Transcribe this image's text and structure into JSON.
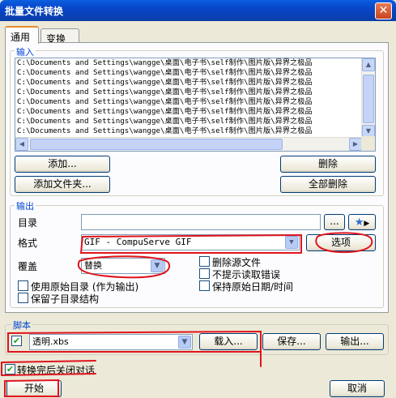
{
  "window": {
    "title": "批量文件转换",
    "close_glyph": "✕"
  },
  "tabs": [
    {
      "label": "通用",
      "active": true
    },
    {
      "label": "变换",
      "active": false
    }
  ],
  "input_group": {
    "label": "输入",
    "files": [
      "C:\\Documents and Settings\\wangge\\桌面\\电子书\\self制作\\图片版\\异界之极品",
      "C:\\Documents and Settings\\wangge\\桌面\\电子书\\self制作\\图片版\\异界之极品",
      "C:\\Documents and Settings\\wangge\\桌面\\电子书\\self制作\\图片版\\异界之极品",
      "C:\\Documents and Settings\\wangge\\桌面\\电子书\\self制作\\图片版\\异界之极品",
      "C:\\Documents and Settings\\wangge\\桌面\\电子书\\self制作\\图片版\\异界之极品",
      "C:\\Documents and Settings\\wangge\\桌面\\电子书\\self制作\\图片版\\异界之极品",
      "C:\\Documents and Settings\\wangge\\桌面\\电子书\\self制作\\图片版\\异界之极品",
      "C:\\Documents and Settings\\wangge\\桌面\\电子书\\self制作\\图片版\\异界之极品"
    ],
    "add_label": "添加...",
    "add_folder_label": "添加文件夹...",
    "delete_label": "删除",
    "delete_all_label": "全部删除"
  },
  "output_group": {
    "label": "输出",
    "dir_label": "目录",
    "dir_value": "",
    "browse_label": "...",
    "format_label": "格式",
    "format_value": "GIF - CompuServe GIF",
    "options_label": "选项",
    "overwrite_label": "覆盖",
    "overwrite_value": "替换",
    "delete_source_label": "删除源文件",
    "no_read_errors_label": "不提示读取错误",
    "keep_date_label": "保持原始日期/时间",
    "use_orig_dir_label": "使用原始目录 (作为输出)",
    "keep_subdir_label": "保留子目录结构"
  },
  "script_group": {
    "label": "脚本",
    "enabled": true,
    "script_value": "透明.xbs",
    "load_label": "载入...",
    "save_label": "保存...",
    "export_label": "输出..."
  },
  "footer": {
    "close_after_label": "转换完后关闭对话",
    "close_after_checked": true,
    "start_label": "开始",
    "cancel_label": "取消"
  },
  "colors": {
    "title_blue": "#0845c8",
    "annotation_red": "#e0141c",
    "group_label_blue": "#0046d5"
  }
}
